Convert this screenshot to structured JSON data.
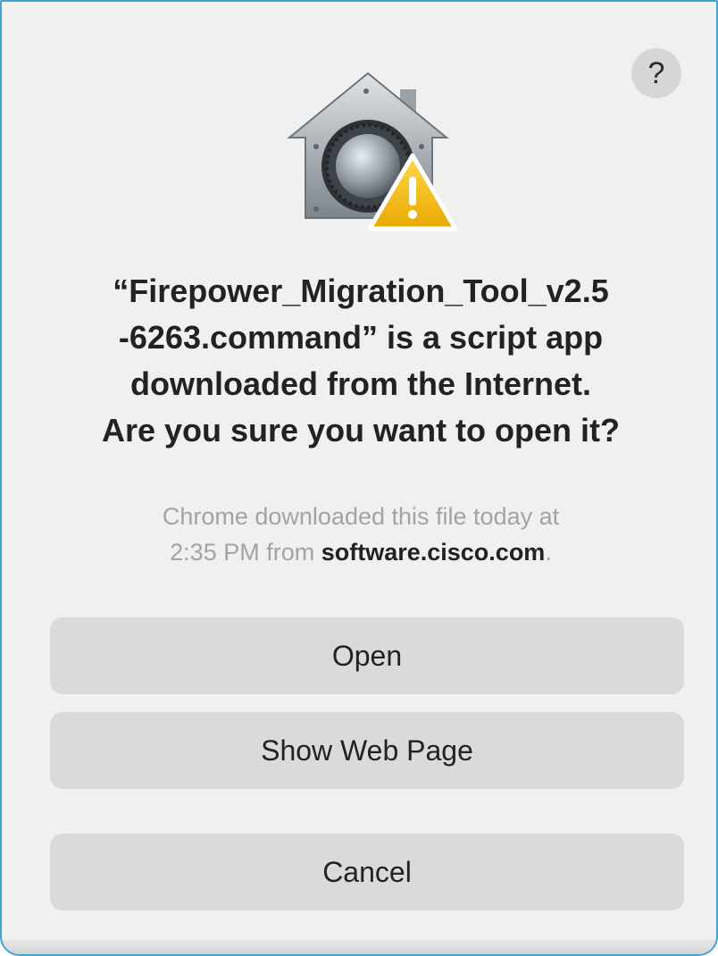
{
  "dialog": {
    "help_label": "?",
    "icon_name": "gatekeeper-warning-icon",
    "title_lines": [
      "“Firepower_Migration_Tool_v2.5",
      "-6263.command” is a script app",
      "downloaded from the Internet.",
      "Are you sure you want to open it?"
    ],
    "subtitle": {
      "line1": "Chrome downloaded this file today at",
      "line2_prefix": "2:35 PM from ",
      "source": "software.cisco.com",
      "line2_suffix": "."
    },
    "buttons": {
      "open": "Open",
      "show_web_page": "Show Web Page",
      "cancel": "Cancel"
    }
  },
  "colors": {
    "accent_border": "#3aa4d9",
    "dialog_bg": "#f0f0f0",
    "button_bg": "#dadada",
    "warning_yellow": "#f5c518"
  }
}
